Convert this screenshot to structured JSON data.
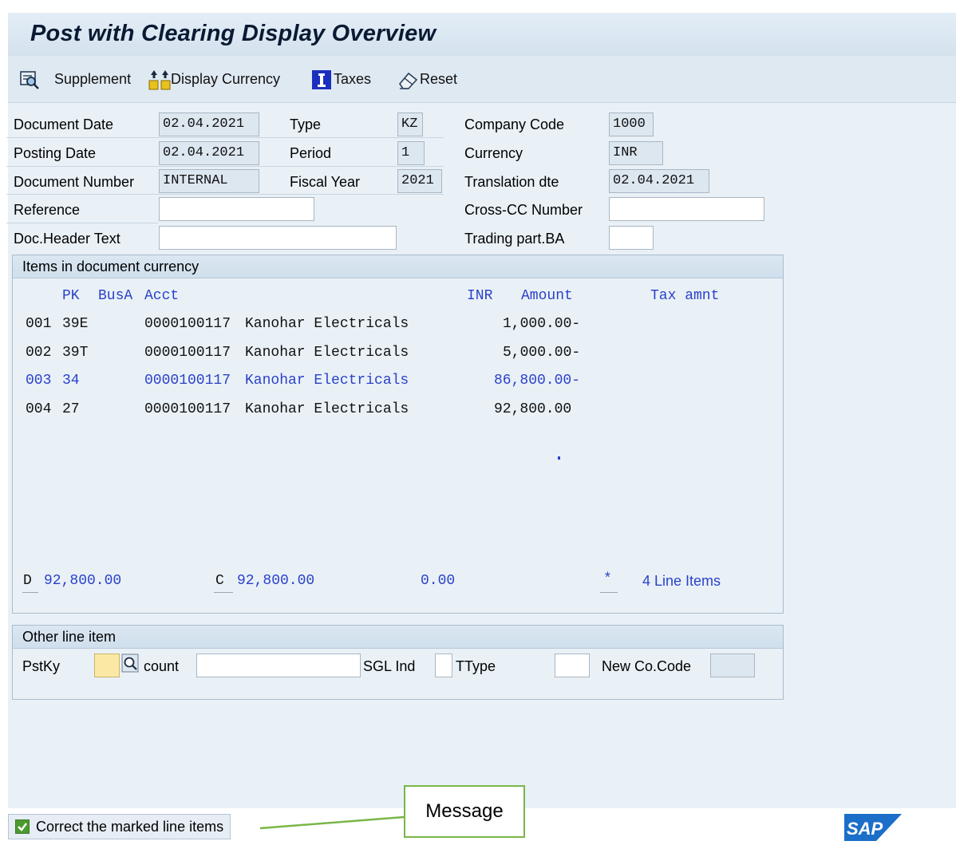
{
  "title": "Post with Clearing Display Overview",
  "toolbar": {
    "supplement": "Supplement",
    "display_currency": "Display Currency",
    "taxes": "Taxes",
    "reset": "Reset"
  },
  "header": {
    "document_date": {
      "label": "Document Date",
      "value": "02.04.2021"
    },
    "posting_date": {
      "label": "Posting Date",
      "value": "02.04.2021"
    },
    "document_number": {
      "label": "Document Number",
      "value": "INTERNAL"
    },
    "reference": {
      "label": "Reference",
      "value": ""
    },
    "doc_header_text": {
      "label": "Doc.Header Text",
      "value": ""
    },
    "type": {
      "label": "Type",
      "value": "KZ"
    },
    "period": {
      "label": "Period",
      "value": "1"
    },
    "fiscal_year": {
      "label": "Fiscal Year",
      "value": "2021"
    },
    "company_code": {
      "label": "Company Code",
      "value": "1000"
    },
    "currency": {
      "label": "Currency",
      "value": "INR"
    },
    "translation_date": {
      "label": "Translation dte",
      "value": "02.04.2021"
    },
    "cross_cc_number": {
      "label": "Cross-CC Number",
      "value": ""
    },
    "trading_part_ba": {
      "label": "Trading part.BA",
      "value": ""
    }
  },
  "items": {
    "title": "Items in document currency",
    "columns": {
      "pk": "PK",
      "busa": "BusA",
      "acct": "Acct",
      "currency": "INR",
      "amount": "Amount",
      "tax": "Tax amnt"
    },
    "rows": [
      {
        "no": "001",
        "pk": "39E",
        "account": "0000100117",
        "name": "Kanohar Electricals",
        "amount": "1,000.00-",
        "highlight": false
      },
      {
        "no": "002",
        "pk": "39T",
        "account": "0000100117",
        "name": "Kanohar Electricals",
        "amount": "5,000.00-",
        "highlight": false
      },
      {
        "no": "003",
        "pk": "34",
        "account": "0000100117",
        "name": "Kanohar Electricals",
        "amount": "86,800.00-",
        "highlight": true
      },
      {
        "no": "004",
        "pk": "27",
        "account": "0000100117",
        "name": "Kanohar Electricals",
        "amount": "92,800.00",
        "highlight": false
      }
    ],
    "totals": {
      "debit_label": "D",
      "debit": "92,800.00",
      "credit_label": "C",
      "credit": "92,800.00",
      "balance": "0.00",
      "marker": "*",
      "line_items": "4 Line Items"
    }
  },
  "other_line_item": {
    "title": "Other line item",
    "pstky_label": "PstKy",
    "pstky_value": "",
    "account_label": "count",
    "account_value": "",
    "sgl_ind_label": "SGL Ind",
    "sgl_ind_value": "",
    "ttype_label": "TType",
    "ttype_value": "",
    "new_co_code_label": "New Co.Code",
    "new_co_code_value": ""
  },
  "status": {
    "message": "Correct the marked line items",
    "callout": "Message"
  },
  "brand": {
    "logo_text": "SAP",
    "color": "#1b6fc9"
  }
}
